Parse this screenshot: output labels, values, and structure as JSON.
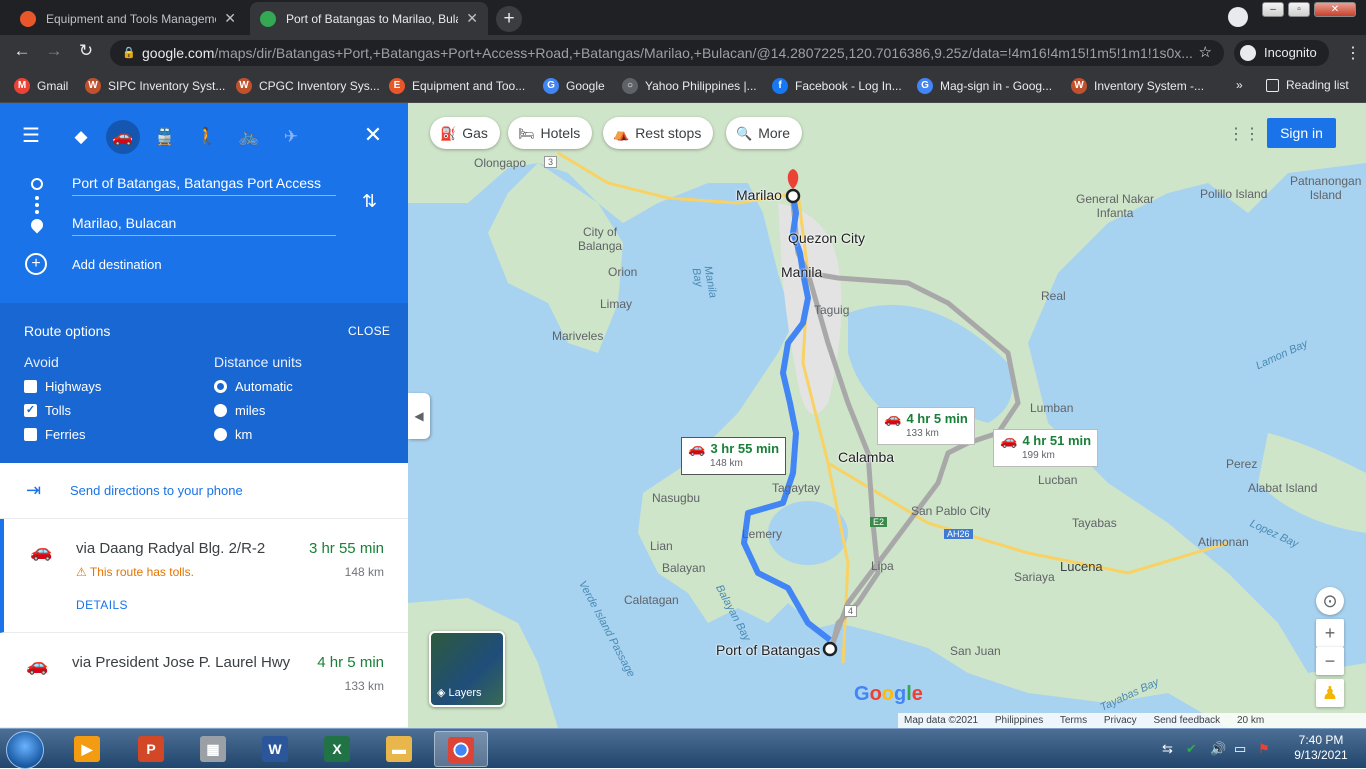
{
  "browser": {
    "tabs": [
      {
        "title": "Equipment and Tools Manageme",
        "active": false,
        "favicon_color": "#e8572a"
      },
      {
        "title": "Port of Batangas to Marilao, Bula",
        "active": true,
        "favicon_color": "#34a853"
      }
    ],
    "new_tab_label": "+",
    "url_main": "google.com",
    "url_rest": "/maps/dir/Batangas+Port,+Batangas+Port+Access+Road,+Batangas/Marilao,+Bulacan/@14.2807225,120.7016386,9.25z/data=!4m16!4m15!1m5!1m1!1s0x...",
    "incognito_label": "Incognito",
    "bookmarks": [
      {
        "label": "Gmail",
        "icon": "gmail-icon",
        "color": "#ea4335"
      },
      {
        "label": "SIPC Inventory Syst...",
        "icon": "w-icon",
        "color": "#c0512d"
      },
      {
        "label": "CPGC Inventory Sys...",
        "icon": "w-icon",
        "color": "#c0512d"
      },
      {
        "label": "Equipment and Too...",
        "icon": "e-icon",
        "color": "#e8572a"
      },
      {
        "label": "Google",
        "icon": "google-icon",
        "color": "#4285f4"
      },
      {
        "label": "Yahoo Philippines |...",
        "icon": "globe-icon",
        "color": "#5f6368"
      },
      {
        "label": "Facebook - Log In...",
        "icon": "facebook-icon",
        "color": "#1877f2"
      },
      {
        "label": "Mag-sign in - Goog...",
        "icon": "google-icon",
        "color": "#4285f4"
      },
      {
        "label": "Inventory System -...",
        "icon": "w-icon",
        "color": "#c0512d"
      }
    ],
    "more_bookmarks": "»",
    "reading_list": "Reading list"
  },
  "directions": {
    "origin": "Port of Batangas, Batangas Port Access",
    "destination": "Marilao, Bulacan",
    "add_destination": "Add destination",
    "route_options": {
      "title": "Route options",
      "close": "CLOSE",
      "avoid_title": "Avoid",
      "avoid": [
        {
          "label": "Highways",
          "checked": false
        },
        {
          "label": "Tolls",
          "checked": true
        },
        {
          "label": "Ferries",
          "checked": false
        }
      ],
      "units_title": "Distance units",
      "units": [
        {
          "label": "Automatic",
          "selected": true
        },
        {
          "label": "miles",
          "selected": false
        },
        {
          "label": "km",
          "selected": false
        }
      ]
    },
    "send_to_phone": "Send directions to your phone",
    "routes": [
      {
        "via": "via Daang Radyal Blg. 2/R-2",
        "time": "3 hr 55 min",
        "distance": "148 km",
        "warning": "This route has tolls.",
        "details": "DETAILS"
      },
      {
        "via": "via President Jose P. Laurel Hwy",
        "time": "4 hr 5 min",
        "distance": "133 km"
      }
    ]
  },
  "map": {
    "chips": [
      {
        "label": "Gas",
        "icon": "gas-pump-icon"
      },
      {
        "label": "Hotels",
        "icon": "bed-icon"
      },
      {
        "label": "Rest stops",
        "icon": "rest-stop-icon"
      },
      {
        "label": "More",
        "icon": "search-icon"
      }
    ],
    "sign_in": "Sign in",
    "places": {
      "olongapo": "Olongapo",
      "marilao": "Marilao",
      "quezon_city": "Quezon City",
      "manila": "Manila",
      "taguig": "Taguig",
      "city_of_balanga": "City of\nBalanga",
      "orion": "Orion",
      "limay": "Limay",
      "mariveles": "Mariveles",
      "manila_bay": "Manila\nBay",
      "general_nakar": "General Nakar\nInfanta",
      "polillo": "Polillo Island",
      "patnanongan": "Patnanongan\nIsland",
      "real": "Real",
      "lamon_bay": "Lamon Bay",
      "lumban": "Lumban",
      "calamba": "Calamba",
      "tagaytay": "Tagaytay",
      "nasugbu": "Nasugbu",
      "lucban": "Lucban",
      "perez": "Perez",
      "alabat": "Alabat Island",
      "san_pablo": "San Pablo City",
      "tayabas": "Tayabas",
      "lopez_bay": "Lopez Bay",
      "atimonan": "Atimonan",
      "lian": "Lian",
      "balayan": "Balayan",
      "lemery": "Lemery",
      "lipa": "Lipa",
      "sariaya": "Sariaya",
      "lucena": "Lucena",
      "calatagan": "Calatagan",
      "balayan_bay": "Balayan Bay",
      "verde": "Verde Island Passage",
      "port_batangas": "Port of Batangas",
      "san_juan": "San Juan",
      "tayabas_bay": "Tayabas Bay",
      "ah26": "AH26",
      "e2": "E2",
      "r3": "3",
      "r4": "4"
    },
    "route_labels": [
      {
        "time": "3 hr 55 min",
        "distance": "148 km"
      },
      {
        "time": "4 hr 5 min",
        "distance": "133 km"
      },
      {
        "time": "4 hr 51 min",
        "distance": "199 km"
      }
    ],
    "layers": "Layers",
    "logo": "Google",
    "footer": [
      "Map data ©2021",
      "Philippines",
      "Terms",
      "Privacy",
      "Send feedback",
      "20 km"
    ],
    "colors": {
      "route_main": "#4285f4",
      "route_alt": "#a8a8a8",
      "land": "#cfe5c9",
      "water": "#a8d3f0",
      "city": "#e3e3e3"
    }
  },
  "taskbar": {
    "time": "7:40 PM",
    "date": "9/13/2021",
    "apps": [
      {
        "name": "media-player",
        "label": "▶",
        "color": "#f39c12"
      },
      {
        "name": "powerpoint",
        "label": "P",
        "color": "#d24726"
      },
      {
        "name": "calculator",
        "label": "▦",
        "color": "#9aa0a6"
      },
      {
        "name": "word",
        "label": "W",
        "color": "#2b579a"
      },
      {
        "name": "excel",
        "label": "X",
        "color": "#217346"
      },
      {
        "name": "file-explorer",
        "label": "▬",
        "color": "#e8b64a"
      },
      {
        "name": "chrome",
        "label": "●",
        "color": "#db4437"
      }
    ]
  }
}
